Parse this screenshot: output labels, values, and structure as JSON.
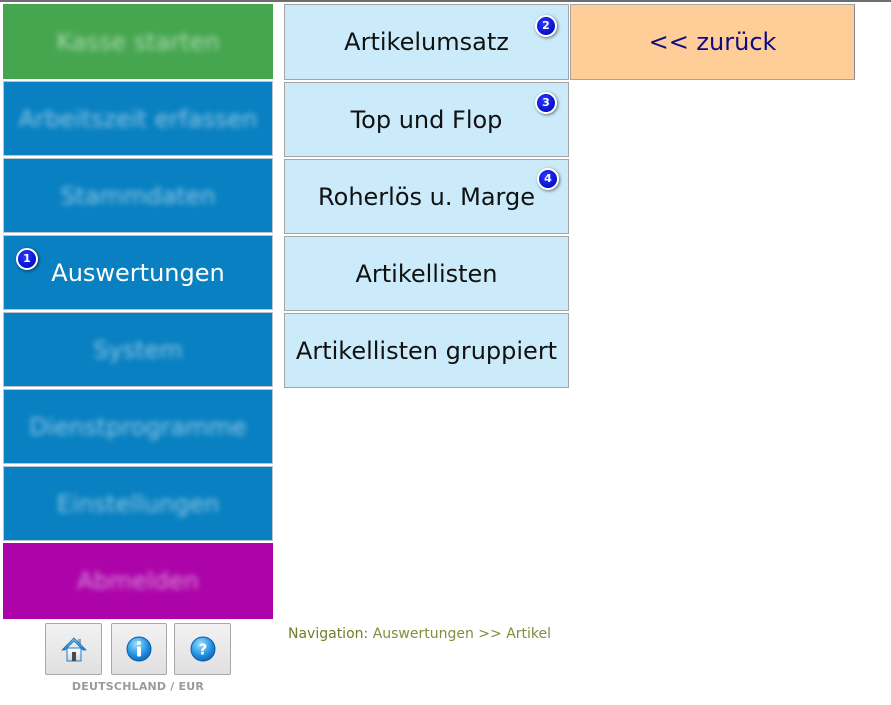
{
  "left_menu": {
    "items": [
      {
        "label": "Kasse starten",
        "color": "#46a64f",
        "blurred": true
      },
      {
        "label": "Arbeitszeit erfassen",
        "color": "#0880c1",
        "blurred": true
      },
      {
        "label": "Stammdaten",
        "color": "#0880c1",
        "blurred": true
      },
      {
        "label": "Auswertungen",
        "color": "#0880c1",
        "blurred": false,
        "badge": "1"
      },
      {
        "label": "System",
        "color": "#0880c1",
        "blurred": true
      },
      {
        "label": "Dienstprogramme",
        "color": "#0880c1",
        "blurred": true
      },
      {
        "label": "Einstellungen",
        "color": "#0880c1",
        "blurred": true
      },
      {
        "label": "Abmelden",
        "color": "#ac04a9",
        "blurred": true
      }
    ]
  },
  "sub_menu": {
    "items": [
      {
        "label": "Artikelumsatz",
        "badge": "2"
      },
      {
        "label": "Top und Flop",
        "badge": "3"
      },
      {
        "label": "Roherlös u. Marge",
        "badge": "4"
      },
      {
        "label": "Artikellisten"
      },
      {
        "label": "Artikellisten gruppiert"
      }
    ],
    "back_label": "<< zurück"
  },
  "footer": {
    "icons": [
      {
        "name": "home-icon"
      },
      {
        "name": "info-icon"
      },
      {
        "name": "help-icon"
      }
    ],
    "locale": "DEUTSCHLAND / EUR"
  },
  "navigation": {
    "label": "Navigation:",
    "path": "Auswertungen >> Artikel"
  },
  "colors": {
    "green": "#46a64f",
    "blue": "#0880c1",
    "purple": "#ac04a9",
    "submenu_bg": "#cbebfb",
    "back_bg": "#fecd98",
    "badge": "#0b14d6"
  }
}
